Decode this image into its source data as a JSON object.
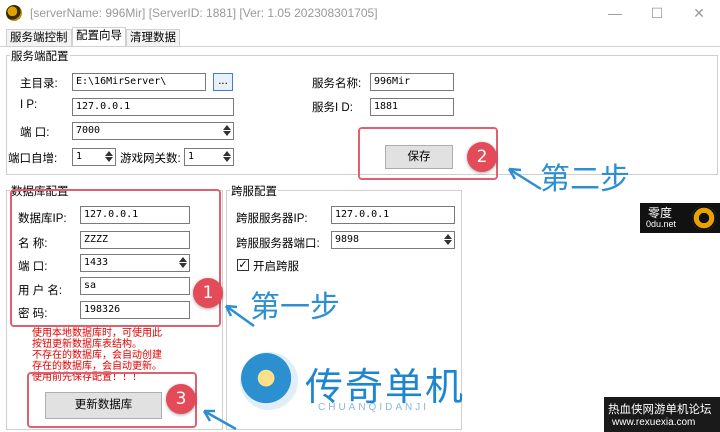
{
  "window": {
    "title": "[serverName: 996Mir] [ServerID: 1881] [Ver:  1.05 202308301705]",
    "controls": {
      "minimize": "—",
      "maximize": "☐",
      "close": "✕"
    }
  },
  "tabs": [
    {
      "label": "服务端控制"
    },
    {
      "label": "配置向导"
    },
    {
      "label": "清理数据"
    }
  ],
  "server_config": {
    "legend": "服务端配置",
    "root_dir_label": "主目录:",
    "root_dir_value": "E:\\16MirServer\\",
    "browse_label": "...",
    "ip_label": "I    P:",
    "ip_value": "127.0.0.1",
    "port_label": "端  口:",
    "port_value": "7000",
    "port_auto_label": "端口自增:",
    "port_auto_value": "1",
    "gateway_label": "游戏网关数:",
    "gateway_value": "1",
    "server_name_label": "服务名称:",
    "server_name_value": "996Mir",
    "server_id_label": "服务I  D:",
    "server_id_value": "1881",
    "save_label": "保存"
  },
  "db_config": {
    "legend": "数据库配置",
    "ip_label": "数据库IP:",
    "ip_value": "127.0.0.1",
    "name_label": "名    称:",
    "name_value": "ZZZZ",
    "port_label": "端    口:",
    "port_value": "1433",
    "user_label": "用 户 名:",
    "user_value": "sa",
    "password_label": "密    码:",
    "password_value": "198326",
    "notes": [
      "使用本地数据库时，可使用此",
      "按钮更新数据库表结构。",
      "不存在的数据库，会自动创建",
      "存在的数据库，会自动更新。",
      "使用前先保存配置！！！"
    ],
    "update_button_label": "更新数据库"
  },
  "cross_config": {
    "legend": "跨服配置",
    "ip_label": "跨服服务器IP:",
    "ip_value": "127.0.0.1",
    "port_label": "跨服服务器端口:",
    "port_value": "9898",
    "enable_label": "开启跨服",
    "enable_checked": true,
    "check_glyph": "✓"
  },
  "annotations": {
    "steps": [
      {
        "number": "1",
        "text": "第一步"
      },
      {
        "number": "2",
        "text": "第二步"
      },
      {
        "number": "3",
        "text": ""
      }
    ],
    "accent_color": "#e24b57",
    "step_text_color": "#2c8fcf"
  },
  "watermarks": {
    "zero_title": "零度",
    "zero_sub": "0du.net",
    "logo_text": "传奇单机",
    "logo_sub": "CHUANQIDANJI",
    "forum_title": "热血侠网游单机论坛",
    "forum_url": "www.rexuexia.com"
  }
}
